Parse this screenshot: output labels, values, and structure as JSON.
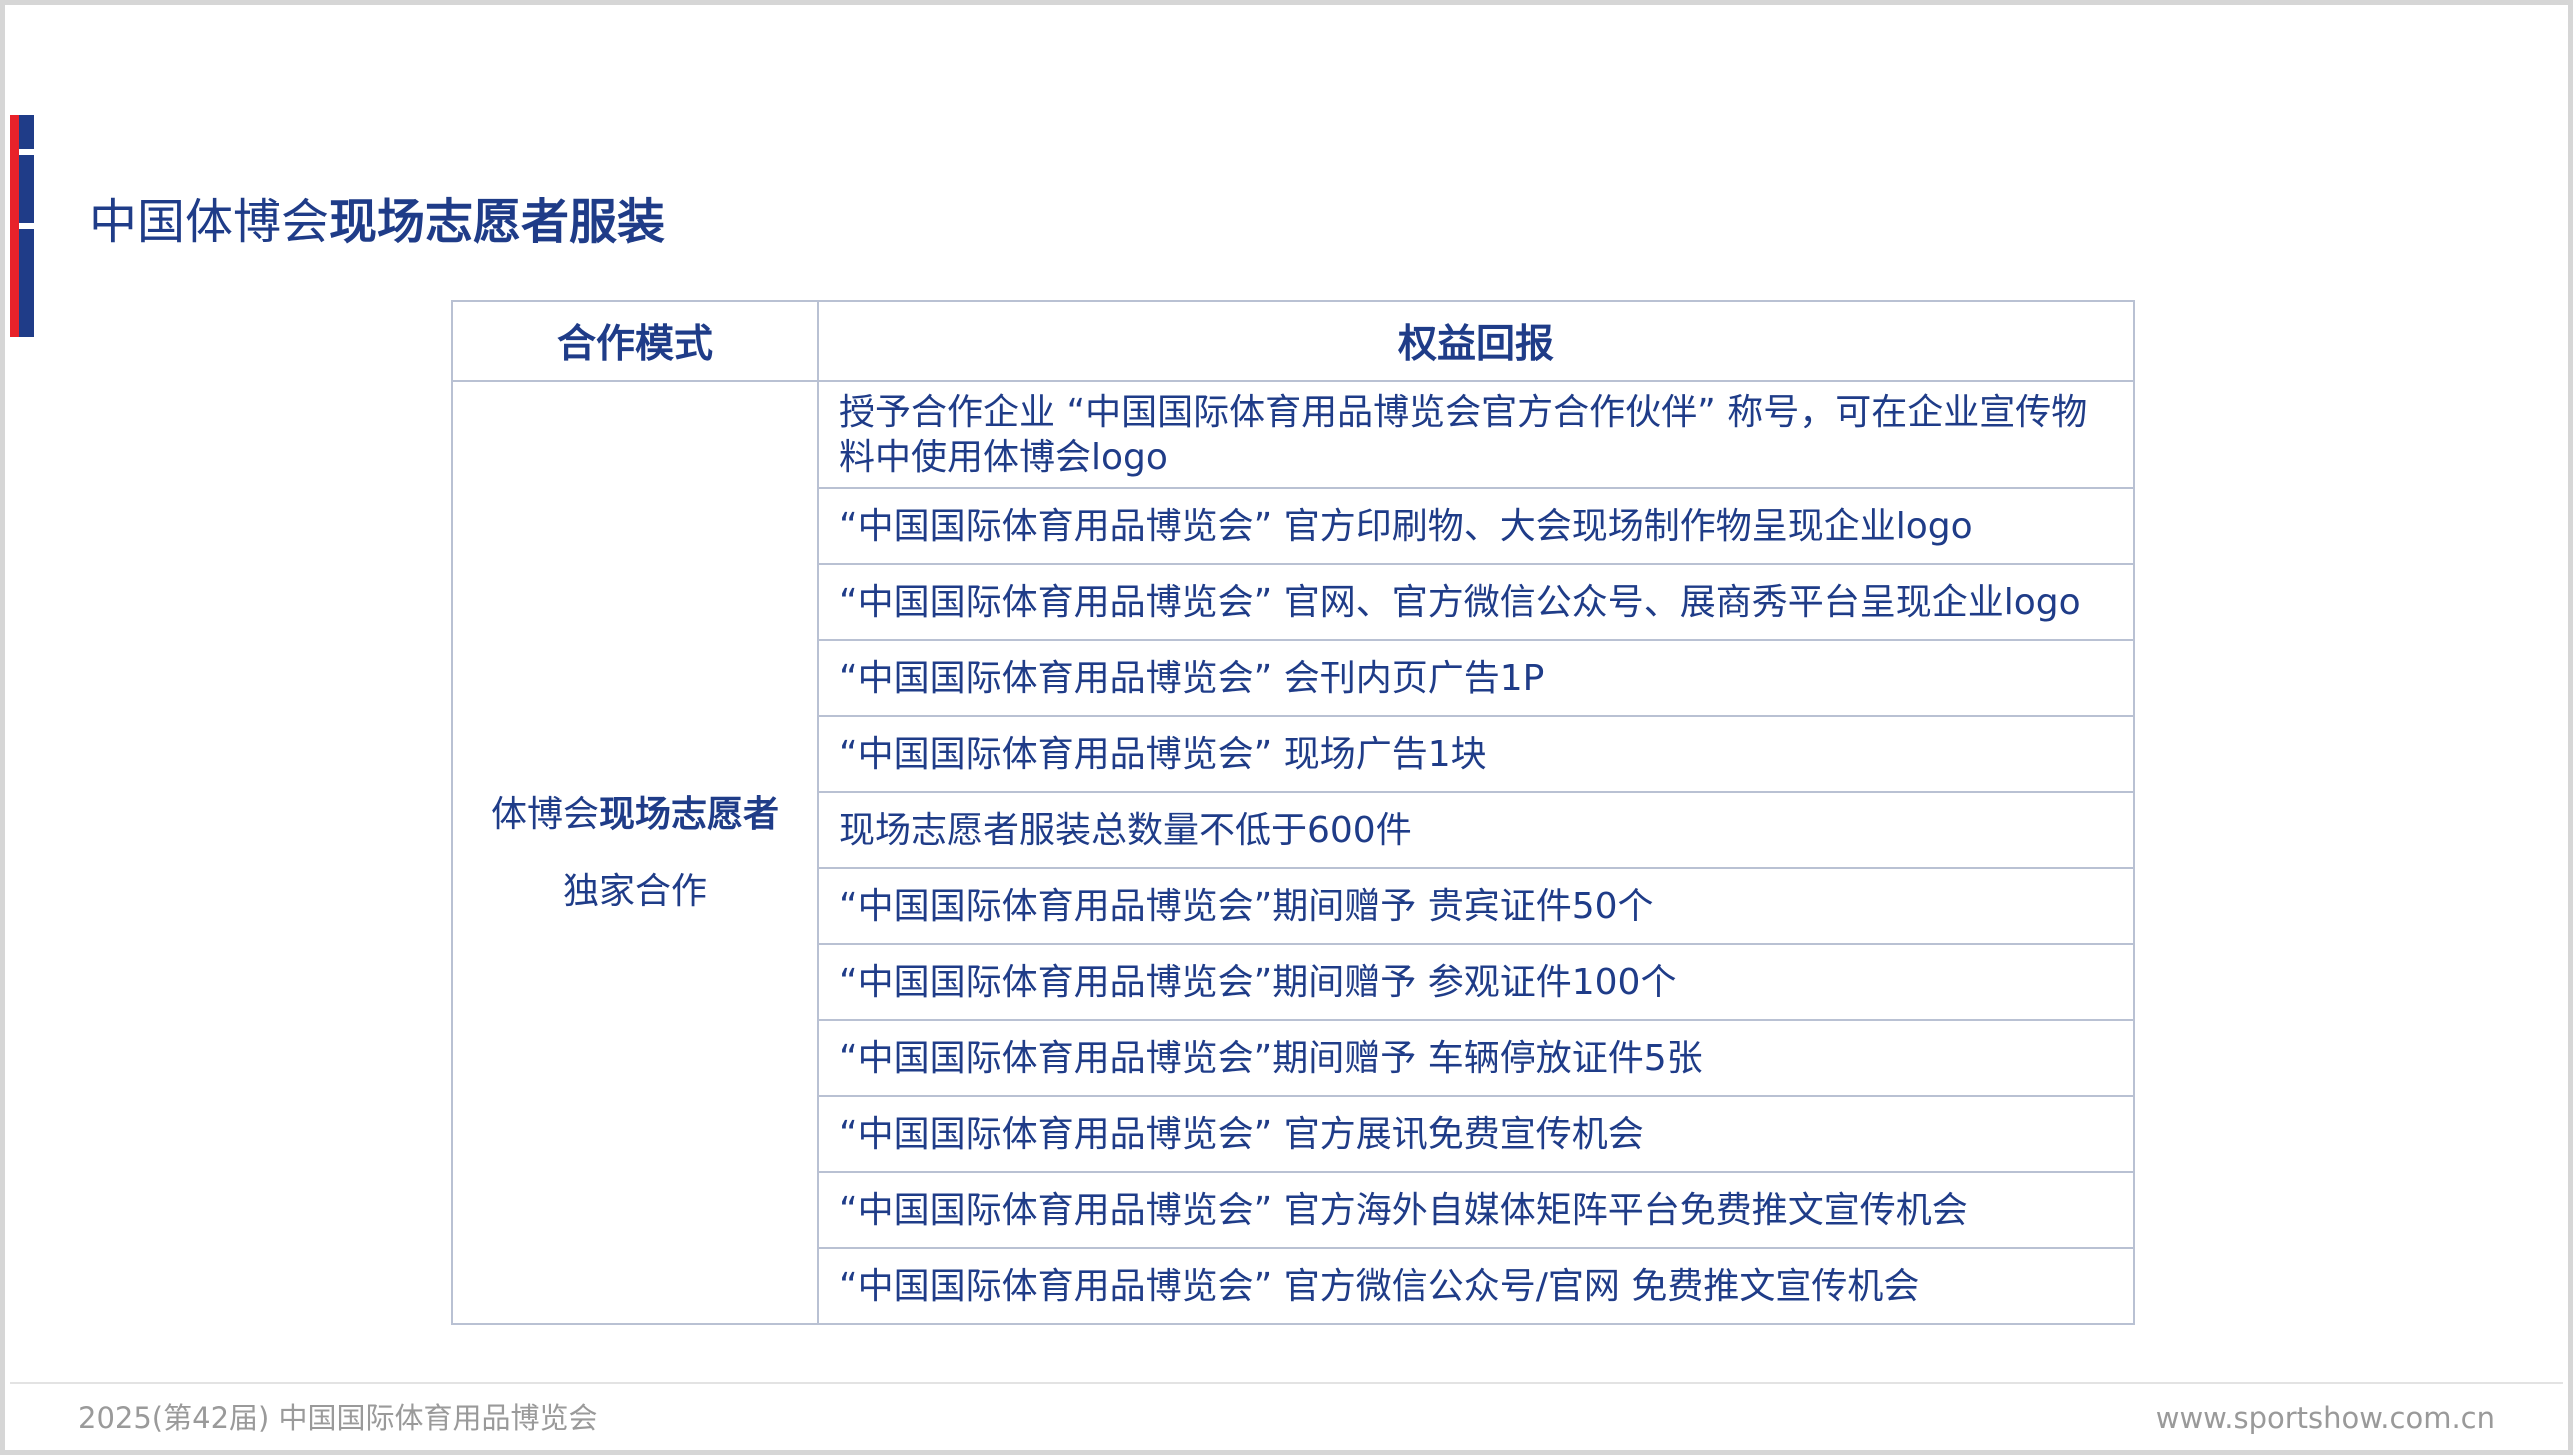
{
  "title": {
    "prefix": "中国体博会",
    "bold": "现场志愿者服装"
  },
  "table": {
    "headers": {
      "mode": "合作模式",
      "benefits": "权益回报"
    },
    "mode": {
      "line1_prefix": "体博会",
      "line1_bold": "现场志愿者",
      "line2": "独家合作"
    },
    "rows": [
      "授予合作企业 “中国国际体育用品博览会官方合作伙伴” 称号，可在企业宣传物料中使用体博会logo",
      "“中国国际体育用品博览会” 官方印刷物、大会现场制作物呈现企业logo",
      "“中国国际体育用品博览会” 官网、官方微信公众号、展商秀平台呈现企业logo",
      "“中国国际体育用品博览会” 会刊内页广告1P",
      "“中国国际体育用品博览会” 现场广告1块",
      " 现场志愿者服装总数量不低于600件",
      "“中国国际体育用品博览会”期间赠予 贵宾证件50个",
      "“中国国际体育用品博览会”期间赠予 参观证件100个",
      "“中国国际体育用品博览会”期间赠予 车辆停放证件5张",
      "“中国国际体育用品博览会” 官方展讯免费宣传机会",
      "“中国国际体育用品博览会” 官方海外自媒体矩阵平台免费推文宣传机会",
      "“中国国际体育用品博览会” 官方微信公众号/官网 免费推文宣传机会"
    ]
  },
  "footer": {
    "left": "2025(第42届) 中国国际体育用品博览会",
    "right": "www.sportshow.com.cn"
  },
  "colors": {
    "brand_blue": "#1f3c88",
    "brand_red": "#e8222a",
    "border": "#b9c1d3",
    "footer_text": "#9a9a9a"
  }
}
